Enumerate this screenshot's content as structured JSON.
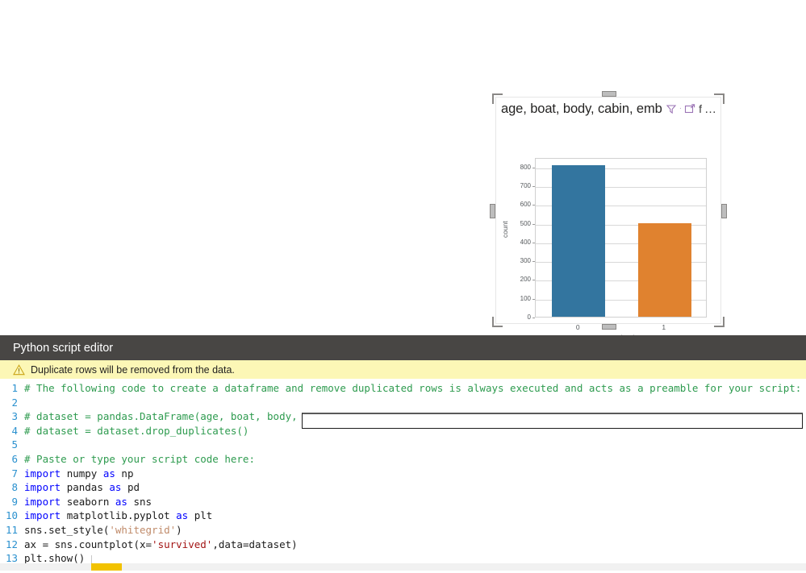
{
  "visual": {
    "title": "age, boat, body, cabin, emb",
    "header_icons": [
      {
        "name": "filter-icon",
        "glyph": "filter"
      },
      {
        "name": "separator",
        "glyph": "·"
      },
      {
        "name": "focus-mode-icon",
        "glyph": "focus"
      },
      {
        "name": "more-options-f",
        "glyph": "f"
      },
      {
        "name": "more-options-ellipsis",
        "glyph": "…"
      }
    ],
    "accent_blue": "#33759f",
    "accent_orange": "#e0822f"
  },
  "chart_data": {
    "type": "bar",
    "title": "",
    "categories": [
      "0",
      "1"
    ],
    "values": [
      809,
      497
    ],
    "series": [
      {
        "name": "count",
        "values": [
          809,
          497
        ],
        "colors": [
          "#33759f",
          "#e0822f"
        ]
      }
    ],
    "xlabel": "survived",
    "ylabel": "count",
    "ylim": [
      0,
      850
    ],
    "yticks": [
      0,
      100,
      200,
      300,
      400,
      500,
      600,
      700,
      800
    ],
    "ytick_labels": [
      "0",
      "100",
      "200",
      "300",
      "400",
      "500",
      "600",
      "700",
      "800"
    ],
    "xtick_labels": [
      "0",
      "1"
    ],
    "grid": true,
    "grid_axis": "y",
    "legend": "none",
    "style": "whitegrid"
  },
  "editor": {
    "header_title": "Python script editor",
    "warning_text": "Duplicate rows will be removed from the data.",
    "warning_icon": "warning-triangle-icon",
    "input_value": "",
    "input_placeholder": "",
    "lines": [
      {
        "n": "1",
        "tokens": [
          {
            "t": "# The following code to create a dataframe and remove duplicated rows is always executed and acts as a preamble for your script:",
            "c": "tok-com"
          }
        ]
      },
      {
        "n": "2",
        "tokens": [
          {
            "t": "",
            "c": "tok-pl"
          }
        ]
      },
      {
        "n": "3",
        "tokens": [
          {
            "t": "# dataset = pandas.DataFrame(age, boat, body, c",
            "c": "tok-com"
          }
        ]
      },
      {
        "n": "4",
        "tokens": [
          {
            "t": "# dataset = dataset.drop_duplicates()",
            "c": "tok-com"
          }
        ]
      },
      {
        "n": "5",
        "tokens": [
          {
            "t": "",
            "c": "tok-pl"
          }
        ]
      },
      {
        "n": "6",
        "tokens": [
          {
            "t": "# Paste or type your script code here:",
            "c": "tok-com"
          }
        ]
      },
      {
        "n": "7",
        "tokens": [
          {
            "t": "import ",
            "c": "tok-kw"
          },
          {
            "t": "numpy ",
            "c": "tok-pl"
          },
          {
            "t": "as ",
            "c": "tok-kw"
          },
          {
            "t": "np",
            "c": "tok-pl"
          }
        ]
      },
      {
        "n": "8",
        "tokens": [
          {
            "t": "import ",
            "c": "tok-kw"
          },
          {
            "t": "pandas ",
            "c": "tok-pl"
          },
          {
            "t": "as ",
            "c": "tok-kw"
          },
          {
            "t": "pd",
            "c": "tok-pl"
          }
        ]
      },
      {
        "n": "9",
        "tokens": [
          {
            "t": "import ",
            "c": "tok-kw"
          },
          {
            "t": "seaborn ",
            "c": "tok-pl"
          },
          {
            "t": "as ",
            "c": "tok-kw"
          },
          {
            "t": "sns",
            "c": "tok-pl"
          }
        ]
      },
      {
        "n": "10",
        "tokens": [
          {
            "t": "import ",
            "c": "tok-kw"
          },
          {
            "t": "matplotlib.pyplot ",
            "c": "tok-pl"
          },
          {
            "t": "as ",
            "c": "tok-kw"
          },
          {
            "t": "plt",
            "c": "tok-pl"
          }
        ]
      },
      {
        "n": "11",
        "tokens": [
          {
            "t": "sns.set_style(",
            "c": "tok-pl"
          },
          {
            "t": "'whitegrid'",
            "c": "tok-str2"
          },
          {
            "t": ")",
            "c": "tok-pl"
          }
        ]
      },
      {
        "n": "12",
        "tokens": [
          {
            "t": "ax = sns.countplot(x=",
            "c": "tok-pl"
          },
          {
            "t": "'survived'",
            "c": "tok-str"
          },
          {
            "t": ",data=dataset)",
            "c": "tok-pl"
          }
        ]
      },
      {
        "n": "13",
        "tokens": [
          {
            "t": "plt.show()",
            "c": "tok-pl"
          }
        ]
      }
    ]
  },
  "scrollbar": {
    "orientation": "horizontal",
    "thumb_color": "#f2c200"
  }
}
